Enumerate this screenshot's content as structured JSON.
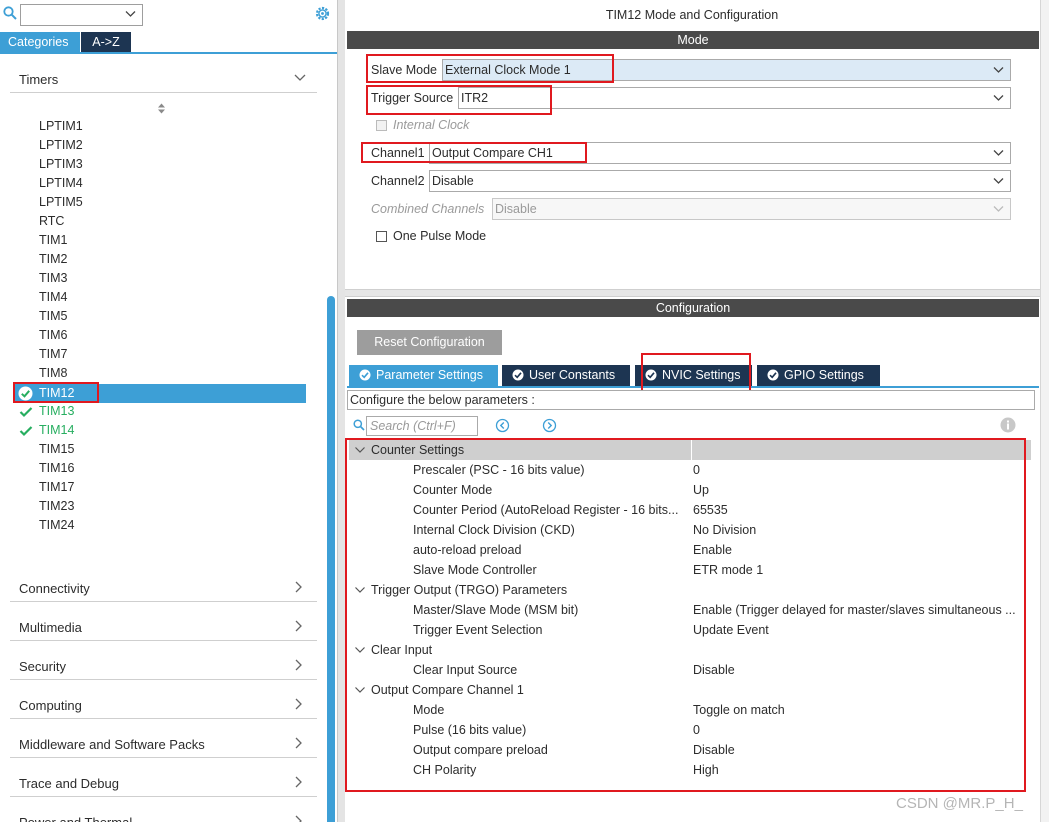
{
  "left": {
    "category_select_value": "",
    "tabs": {
      "categories": "Categories",
      "atoz": "A->Z"
    },
    "timers_header": "Timers",
    "timers": [
      {
        "label": "LPTIM1",
        "state": "normal"
      },
      {
        "label": "LPTIM2",
        "state": "normal"
      },
      {
        "label": "LPTIM3",
        "state": "normal"
      },
      {
        "label": "LPTIM4",
        "state": "normal"
      },
      {
        "label": "LPTIM5",
        "state": "normal"
      },
      {
        "label": "RTC",
        "state": "normal"
      },
      {
        "label": "TIM1",
        "state": "normal"
      },
      {
        "label": "TIM2",
        "state": "normal"
      },
      {
        "label": "TIM3",
        "state": "normal"
      },
      {
        "label": "TIM4",
        "state": "normal"
      },
      {
        "label": "TIM5",
        "state": "normal"
      },
      {
        "label": "TIM6",
        "state": "normal"
      },
      {
        "label": "TIM7",
        "state": "normal"
      },
      {
        "label": "TIM8",
        "state": "normal"
      },
      {
        "label": "TIM12",
        "state": "selected"
      },
      {
        "label": "TIM13",
        "state": "configured"
      },
      {
        "label": "TIM14",
        "state": "configured"
      },
      {
        "label": "TIM15",
        "state": "normal"
      },
      {
        "label": "TIM16",
        "state": "normal"
      },
      {
        "label": "TIM17",
        "state": "normal"
      },
      {
        "label": "TIM23",
        "state": "normal"
      },
      {
        "label": "TIM24",
        "state": "normal"
      }
    ],
    "categories": [
      "Connectivity",
      "Multimedia",
      "Security",
      "Computing",
      "Middleware and Software Packs",
      "Trace and Debug",
      "Power and Thermal"
    ]
  },
  "right": {
    "title": "TIM12 Mode and Configuration",
    "mode_bar": "Mode",
    "mode": {
      "slave_mode_label": "Slave Mode",
      "slave_mode_value": "External Clock Mode 1",
      "trigger_source_label": "Trigger Source",
      "trigger_source_value": "ITR2",
      "internal_clock_label": "Internal Clock",
      "channel1_label": "Channel1",
      "channel1_value": "Output Compare CH1",
      "channel2_label": "Channel2",
      "channel2_value": "Disable",
      "combined_label": "Combined Channels",
      "combined_value": "Disable",
      "one_pulse_label": "One Pulse Mode"
    },
    "config_bar": "Configuration",
    "reset_button": "Reset Configuration",
    "tabs": {
      "parameter": "Parameter Settings",
      "user_constants": "User Constants",
      "nvic": "NVIC Settings",
      "gpio": "GPIO Settings"
    },
    "configure_text": "Configure the below parameters :",
    "search_placeholder": "Search (Ctrl+F)",
    "groups": {
      "counter": {
        "name": "Counter Settings",
        "params": [
          {
            "name": "Prescaler (PSC - 16 bits value)",
            "value": "0"
          },
          {
            "name": "Counter Mode",
            "value": "Up"
          },
          {
            "name": "Counter Period (AutoReload Register - 16 bits...",
            "value": "65535"
          },
          {
            "name": "Internal Clock Division (CKD)",
            "value": "No Division"
          },
          {
            "name": "auto-reload preload",
            "value": "Enable"
          },
          {
            "name": "Slave Mode Controller",
            "value": "ETR mode 1"
          }
        ]
      },
      "trgo": {
        "name": "Trigger Output (TRGO) Parameters",
        "params": [
          {
            "name": "Master/Slave Mode (MSM bit)",
            "value": "Enable (Trigger delayed for master/slaves simultaneous ..."
          },
          {
            "name": "Trigger Event Selection",
            "value": "Update Event"
          }
        ]
      },
      "clear": {
        "name": "Clear Input",
        "params": [
          {
            "name": "Clear Input Source",
            "value": "Disable"
          }
        ]
      },
      "oc1": {
        "name": "Output Compare Channel 1",
        "params": [
          {
            "name": "Mode",
            "value": "Toggle on match"
          },
          {
            "name": "Pulse (16 bits value)",
            "value": "0"
          },
          {
            "name": "Output compare preload",
            "value": "Disable"
          },
          {
            "name": "CH Polarity",
            "value": "High"
          }
        ]
      }
    }
  },
  "watermark": "CSDN @MR.P_H_",
  "colors": {
    "accent": "#3d9fd6",
    "dark_tab": "#1d3552",
    "bar": "#4a4a4a",
    "configured_green": "#27ae60",
    "annotation_red": "#e0191f"
  }
}
